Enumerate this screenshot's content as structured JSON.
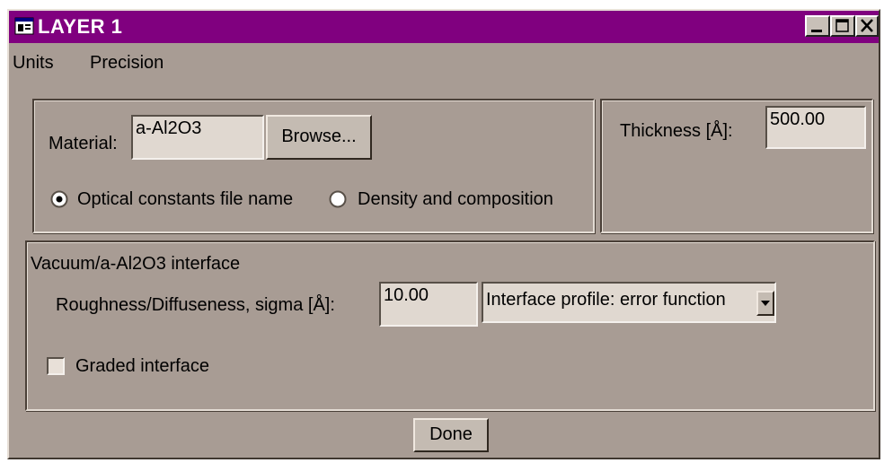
{
  "window": {
    "title": "LAYER 1",
    "icons": {
      "app": "app-window-icon",
      "minimize": "minimize-icon",
      "maximize": "maximize-icon",
      "close": "close-icon"
    },
    "colors": {
      "titlebar": "#80007f",
      "face": "#a89c94"
    }
  },
  "menu": {
    "units": "Units",
    "precision": "Precision"
  },
  "material": {
    "label": "Material:",
    "value": "a-Al2O3",
    "browse_label": "Browse..."
  },
  "source": {
    "options": [
      {
        "label": "Optical constants file name",
        "selected": true
      },
      {
        "label": "Density and composition",
        "selected": false
      }
    ]
  },
  "thickness": {
    "label": "Thickness [Å]:",
    "value": "500.00"
  },
  "interface": {
    "title": "Vacuum/a-Al2O3 interface",
    "roughness_label": "Roughness/Diffuseness, sigma [Å]:",
    "roughness_value": "10.00",
    "profile_selected": "Interface profile: error function",
    "graded_label": "Graded interface",
    "graded_checked": false
  },
  "footer": {
    "done_label": "Done"
  }
}
